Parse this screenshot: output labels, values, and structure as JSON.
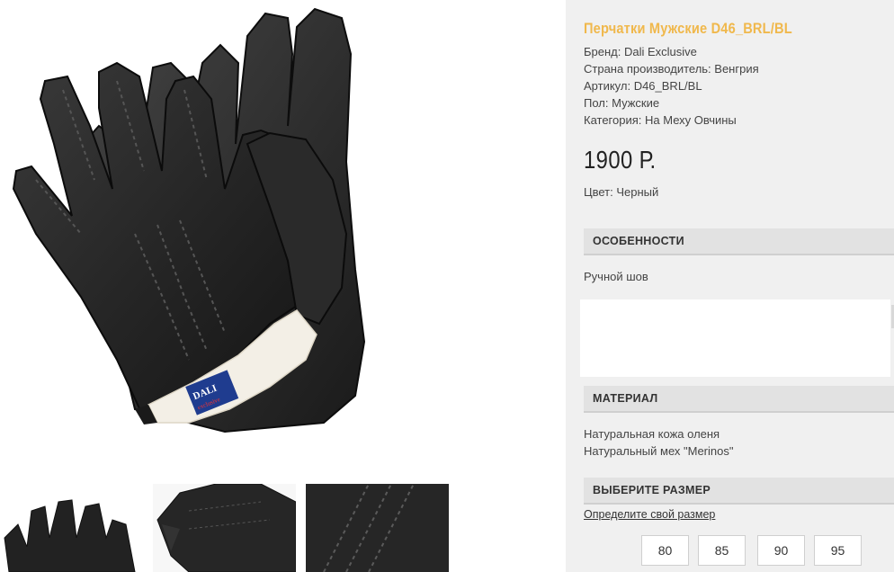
{
  "product": {
    "title": "Перчатки Мужские D46_BRL/BL",
    "brand": "Бренд: Dali Exclusive",
    "country": "Страна производитель: Венгрия",
    "article": "Артикул: D46_BRL/BL",
    "gender": "Пол: Мужские",
    "category": "Категория: На Меху Овчины",
    "price": "1900 Р.",
    "color": "Цвет: Черный"
  },
  "sections": {
    "features_title": "ОСОБЕННОСТИ",
    "features_text": "Ручной шов",
    "material_title": "МАТЕРИАЛ",
    "material_lines": [
      "Натуральная кожа оленя",
      "Натуральный мех \"Merinos\""
    ],
    "size_title": "ВЫБЕРИТЕ РАЗМЕР",
    "size_link": "Определите свой размер",
    "sizes": [
      "80",
      "85",
      "90",
      "95"
    ]
  },
  "image": {
    "label_brand": "DALI",
    "label_line": "exclusive"
  },
  "colors": {
    "title": "#f0b84c",
    "panel": "#f0f0f0",
    "section_header": "#e2e2e2"
  }
}
